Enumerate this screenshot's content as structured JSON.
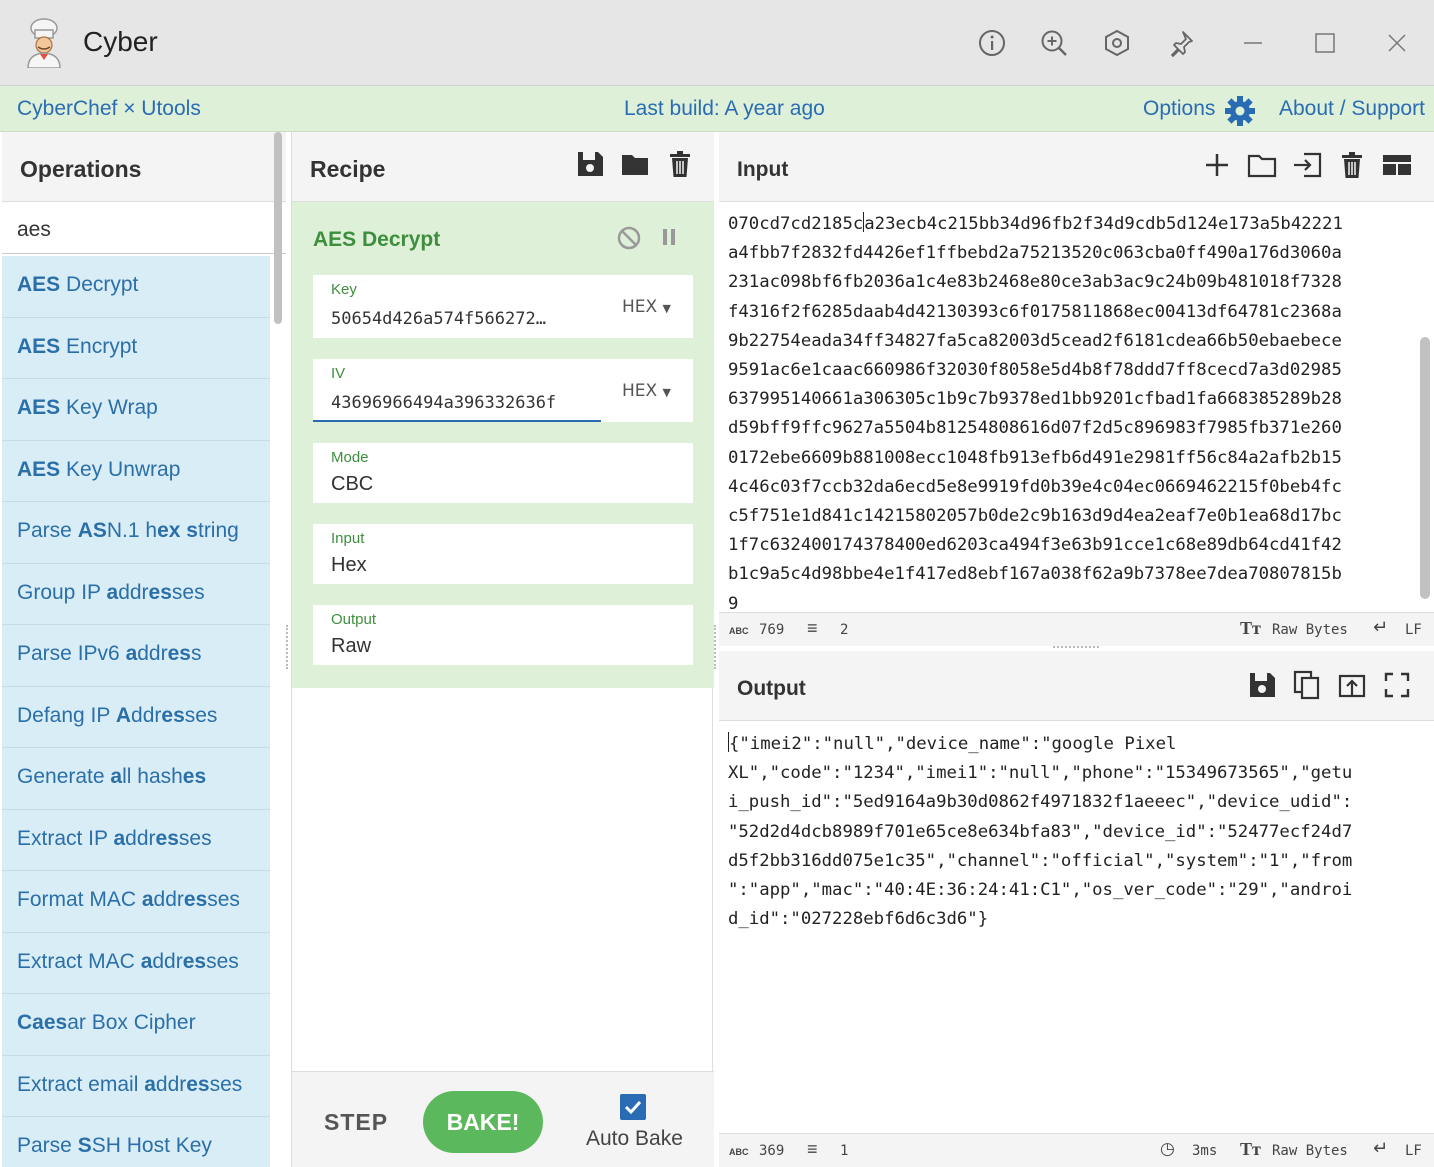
{
  "window": {
    "title": "Cyber",
    "controls": [
      "info-icon",
      "zoom-in-icon",
      "settings-hex-icon",
      "pin-icon",
      "minimize-icon",
      "maximize-icon",
      "close-icon"
    ]
  },
  "banner": {
    "left": "CyberChef × Utools",
    "center": "Last build: A year ago",
    "options": "Options",
    "about": "About / Support"
  },
  "operations": {
    "header": "Operations",
    "search_value": "aes",
    "items": [
      {
        "pre": "",
        "bold": "AES",
        "post": " Decrypt"
      },
      {
        "pre": "",
        "bold": "AES",
        "post": " Encrypt"
      },
      {
        "pre": "",
        "bold": "AES",
        "post": " Key Wrap"
      },
      {
        "pre": "",
        "bold": "AES",
        "post": " Key Unwrap"
      },
      {
        "pre": "Parse ",
        "bold": "AS",
        "post": "N.1 h|ex| |s|tring"
      },
      {
        "pre": "Group IP ",
        "bold": "a",
        "post": "ddr|es|ses"
      },
      {
        "pre": "Parse IPv6 ",
        "bold": "a",
        "post": "ddr|es|s"
      },
      {
        "pre": "Defang IP ",
        "bold": "A",
        "post": "ddr|es|ses"
      },
      {
        "pre": "Generate ",
        "bold": "a",
        "post": "ll hash|es|"
      },
      {
        "pre": "Extract IP ",
        "bold": "a",
        "post": "ddr|es|ses"
      },
      {
        "pre": "Format MAC ",
        "bold": "a",
        "post": "ddr|es|ses"
      },
      {
        "pre": "Extract MAC ",
        "bold": "a",
        "post": "ddr|es|ses"
      },
      {
        "pre": "",
        "bold": "Ca",
        "post": "|es|ar Box Cipher"
      },
      {
        "pre": "Extract email ",
        "bold": "a",
        "post": "ddr|es|ses"
      },
      {
        "pre": "Parse ",
        "bold": "S",
        "post": "SH Host Key"
      }
    ]
  },
  "recipe": {
    "header": "Recipe",
    "operation": {
      "title": "AES Decrypt",
      "key_label": "Key",
      "key_value": "50654d426a574f566272…",
      "key_format": "HEX",
      "iv_label": "IV",
      "iv_value": "43696966494a396332636f",
      "iv_format": "HEX",
      "mode_label": "Mode",
      "mode_value": "CBC",
      "input_label": "Input",
      "input_value": "Hex",
      "output_label": "Output",
      "output_value": "Raw"
    },
    "step_label": "STEP",
    "bake_label": "BAKE!",
    "auto_bake_label": "Auto Bake",
    "auto_bake_checked": true
  },
  "input": {
    "header": "Input",
    "text": "070cd7cd2185ca23ecb4c215bb34d96fb2f34d9cdb5d124e173a5b42221\na4fbb7f2832fd4426ef1ffbebd2a75213520c063cba0ff490a176d3060a\n231ac098bf6fb2036a1c4e83b2468e80ce3ab3ac9c24b09b481018f7328\nf4316f2f6285daab4d42130393c6f0175811868ec00413df64781c2368a\n9b22754eada34ff34827fa5ca82003d5cead2f6181cdea66b50ebaebece\n9591ac6e1caac660986f32030f8058e5d4b8f78ddd7ff8cecd7a3d02985\n637995140661a306305c1b9c7b9378ed1bb9201cfbad1fa668385289b28\nd59bff9ffc9627a5504b81254808616d07f2d5c896983f7985fb371e260\n0172ebe6609b881008ecc1048fb913efb6d491e2981ff56c84a2afb2b15\n4c46c03f7ccb32da6ecd5e8e9919fd0b39e4c04ec0669462215f0beb4fc\nc5f751e1d841c14215802057b0de2c9b163d9d4ea2eaf7e0b1ea68d17bc\n1f7c632400174378400ed6203ca494f3e63b91cce1c68e89db64cd41f42\nb1c9a5c4d98bbe4e1f417ed8ebf167a038f62a9b7378ee7dea70807815b\n9",
    "status": {
      "abc": "ABC",
      "length": "769",
      "lines": "2",
      "encoding": "Raw Bytes",
      "eol": "LF"
    }
  },
  "output": {
    "header": "Output",
    "text": "{\"imei2\":\"null\",\"device_name\":\"google Pixel\nXL\",\"code\":\"1234\",\"imei1\":\"null\",\"phone\":\"15349673565\",\"getu\ni_push_id\":\"5ed9164a9b30d0862f4971832f1aeeec\",\"device_udid\":\n\"52d2d4dcb8989f701e65ce8e634bfa83\",\"device_id\":\"52477ecf24d7\nd5f2bb316dd075e1c35\",\"channel\":\"official\",\"system\":\"1\",\"from\n\":\"app\",\"mac\":\"40:4E:36:24:41:C1\",\"os_ver_code\":\"29\",\"androi\nd_id\":\"027228ebf6d6c3d6\"}",
    "status": {
      "abc": "ABC",
      "length": "369",
      "lines": "1",
      "time": "3ms",
      "encoding": "Raw Bytes",
      "eol": "LF"
    }
  },
  "colors": {
    "banner_bg": "#dff0d8",
    "link": "#2a6cb4",
    "op_item_bg": "#d9edf7",
    "recipe_card_bg": "#dff0d8",
    "recipe_label": "#3d8f3d",
    "bake": "#5cb85c"
  }
}
